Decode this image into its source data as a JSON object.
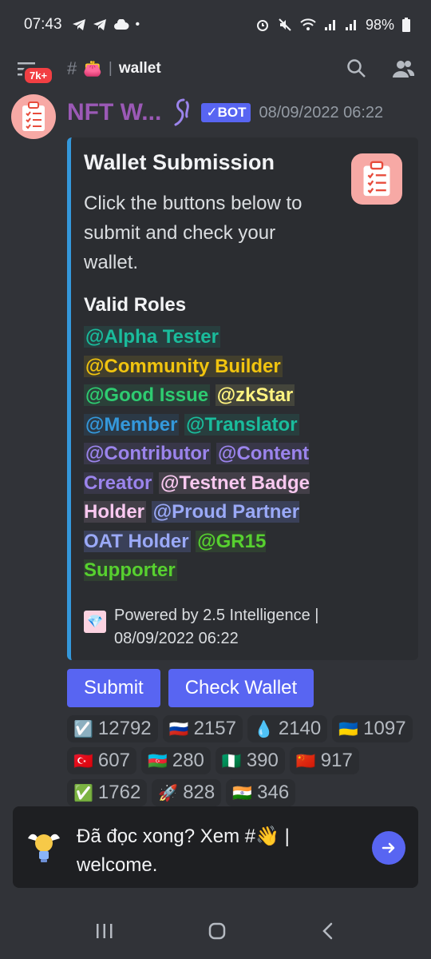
{
  "status_bar": {
    "time": "07:43",
    "battery": "98%"
  },
  "header": {
    "notification_badge": "7k+",
    "channel_emoji": "👛",
    "channel_name": "wallet"
  },
  "message": {
    "author": "NFT W...",
    "bot_tag": "✓BOT",
    "timestamp": "08/09/2022 06:22"
  },
  "embed": {
    "accent_color": "#3498db",
    "title": "Wallet Submission",
    "description": "Click the buttons below to submit and check your wallet.",
    "field_name": "Valid Roles",
    "roles": [
      {
        "label": "@Alpha Tester",
        "color": "#1abc9c",
        "bg": "rgba(26,188,156,0.12)"
      },
      {
        "label": "@Community Builder",
        "color": "#f1c40f",
        "bg": "rgba(241,196,15,0.12)"
      },
      {
        "label": "@Good Issue",
        "color": "#2ecc71",
        "bg": "rgba(46,204,113,0.12)"
      },
      {
        "label": "@zkStar",
        "color": "#fff380",
        "bg": "rgba(255,243,128,0.12)"
      },
      {
        "label": "@Member",
        "color": "#3498db",
        "bg": "rgba(52,152,219,0.12)"
      },
      {
        "label": "@Translator",
        "color": "#1abc9c",
        "bg": "rgba(26,188,156,0.12)"
      },
      {
        "label": "@Contributor",
        "color": "#9b84ec",
        "bg": "rgba(155,132,236,0.12)"
      },
      {
        "label": "@Content Creator",
        "color": "#9b84ec",
        "bg": "rgba(155,132,236,0.12)"
      },
      {
        "label": "@Testnet Badge Holder",
        "color": "#f8c8ef",
        "bg": "rgba(248,200,239,0.12)"
      },
      {
        "label": "@Proud Partner OAT Holder",
        "color": "#9aa9f7",
        "bg": "rgba(120,140,247,0.2)"
      },
      {
        "label": "@GR15 Supporter",
        "color": "#57d12f",
        "bg": "rgba(87,209,47,0.12)"
      }
    ],
    "footer_text": "Powered by 2.5 Intelligence | 08/09/2022 06:22"
  },
  "buttons": {
    "submit": "Submit",
    "check_wallet": "Check Wallet"
  },
  "reactions": [
    {
      "emoji": "☑️",
      "count": "12792"
    },
    {
      "emoji": "🇷🇺",
      "count": "2157"
    },
    {
      "emoji": "💧",
      "count": "2140"
    },
    {
      "emoji": "🇺🇦",
      "count": "1097"
    },
    {
      "emoji": "🇹🇷",
      "count": "607"
    },
    {
      "emoji": "🇦🇿",
      "count": "280"
    },
    {
      "emoji": "🇳🇬",
      "count": "390"
    },
    {
      "emoji": "🇨🇳",
      "count": "917"
    },
    {
      "emoji": "✅",
      "count": "1762"
    },
    {
      "emoji": "🚀",
      "count": "828"
    },
    {
      "emoji": "🇮🇳",
      "count": "346"
    }
  ],
  "tip": {
    "text": "Đã đọc xong? Xem #👋 | welcome."
  },
  "colors": {
    "blurple": "#5865f2",
    "author": "#9b59b6",
    "background": "#313338"
  }
}
